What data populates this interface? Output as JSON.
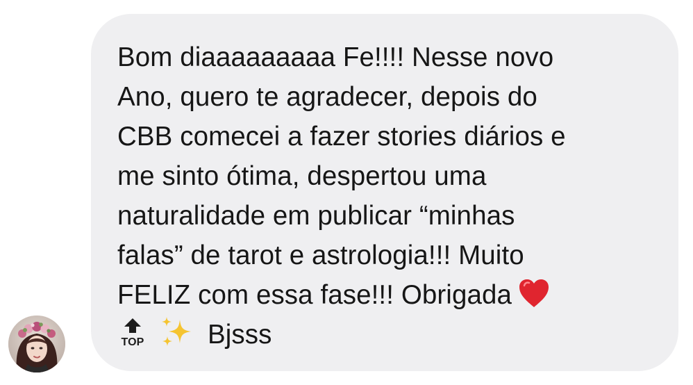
{
  "message": {
    "lines": [
      "Bom diaaaaaaaaa Fe!!!! Nesse novo",
      "Ano, quero te agradecer, depois do",
      "CBB comecei a fazer stories diários e",
      "me sinto ótima, despertou uma",
      "naturalidade em publicar “minhas",
      "falas” de tarot e astrologia!!! Muito",
      "FELIZ com essa fase!!! Obrigada"
    ],
    "last_line_text": "Bjsss",
    "top_icon_label": "TOP",
    "emojis": [
      "heart-icon",
      "top-arrow-icon",
      "sparkles-icon"
    ]
  },
  "colors": {
    "bubble_background": "#efeff1",
    "text": "#161616",
    "heart": "#e0252f",
    "sparkles": "#f5c431"
  },
  "avatar": {
    "icon": "user-avatar-flower-crown"
  }
}
